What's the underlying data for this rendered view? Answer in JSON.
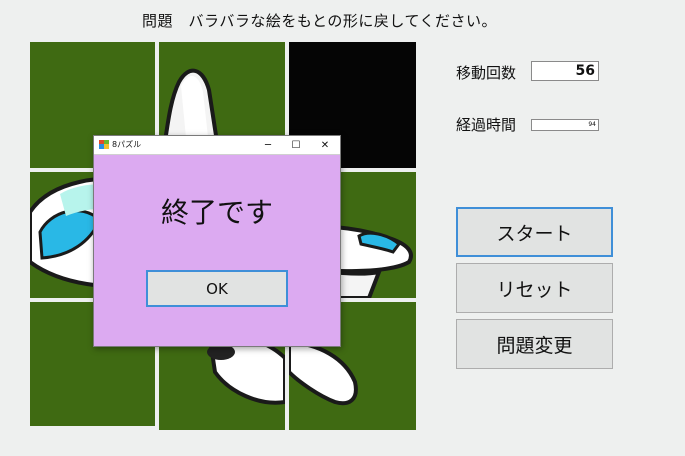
{
  "question": "問題　バラバラな絵をもとの形に戻してください。",
  "stats": {
    "moves_label": "移動回数",
    "moves_value": "56",
    "time_label": "経過時間",
    "time_value": "94"
  },
  "buttons": {
    "start": "スタート",
    "reset": "リセット",
    "change": "問題変更"
  },
  "dialog": {
    "title": "8パズル",
    "message": "終了です",
    "ok": "OK",
    "minimize": "─",
    "maximize": "☐",
    "close": "✕"
  },
  "colors": {
    "tile_green": "#3f6a12",
    "blank_tile": "#050505",
    "dialog_background": "#dcaaf1",
    "accent_border": "#3f8fd8"
  },
  "icons": [
    "window-app-icon",
    "minimize-icon",
    "maximize-icon",
    "close-icon"
  ]
}
